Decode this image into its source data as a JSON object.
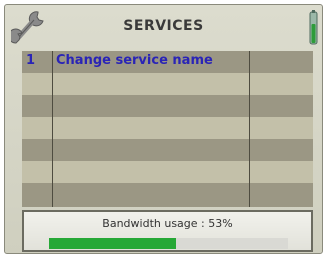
{
  "header": {
    "title": "SERVICES",
    "left_icon": "wrench-icon",
    "right_icon": "signal-strength-icon"
  },
  "services": [
    {
      "number": "1",
      "name": "Change service name"
    },
    {
      "number": "",
      "name": ""
    },
    {
      "number": "",
      "name": ""
    },
    {
      "number": "",
      "name": ""
    },
    {
      "number": "",
      "name": ""
    },
    {
      "number": "",
      "name": ""
    },
    {
      "number": "",
      "name": ""
    }
  ],
  "bandwidth": {
    "label": "Bandwidth usage : 53%",
    "usage_percent": 53
  },
  "colors": {
    "text_accent": "#2a24b6",
    "bar_fill": "#26a836"
  }
}
